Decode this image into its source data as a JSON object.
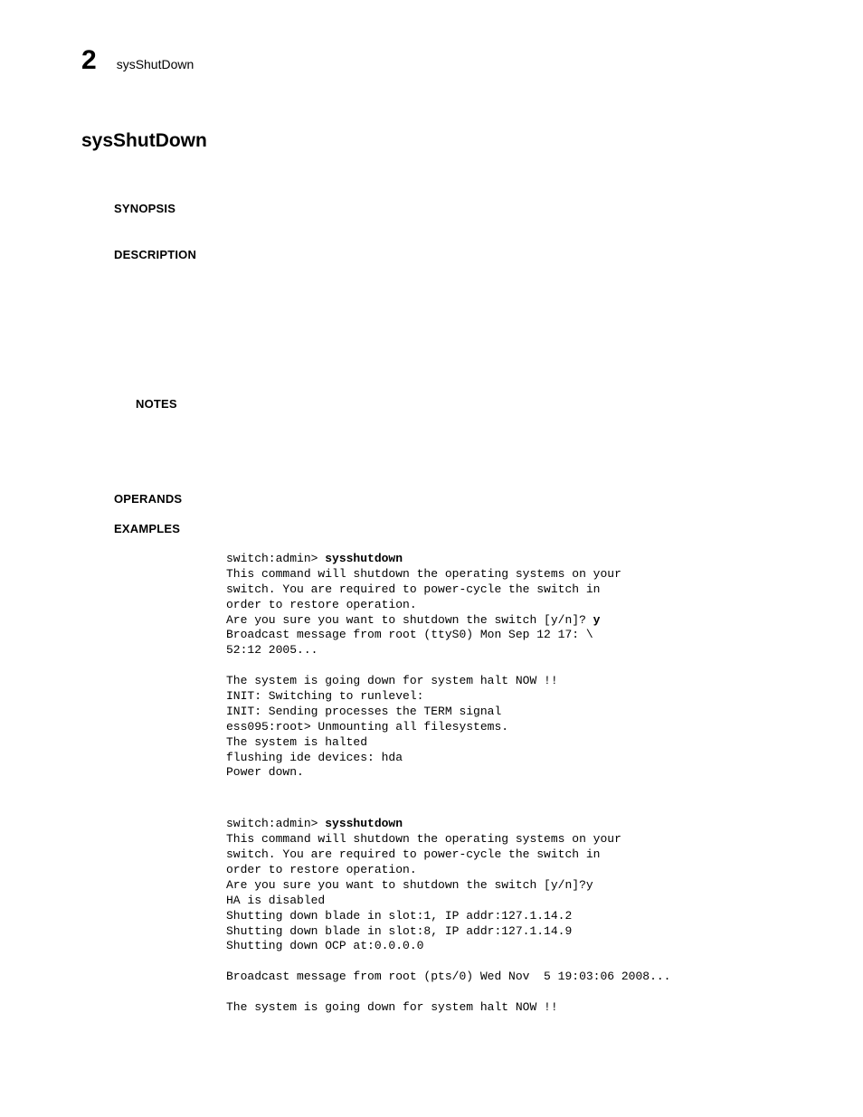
{
  "header": {
    "chapter_number": "2",
    "tag": "sysShutDown"
  },
  "title": "sysShutDown",
  "sections": {
    "synopsis_label": "SYNOPSIS",
    "description_label": "DESCRIPTION",
    "notes_label": "NOTES",
    "operands_label": "OPERANDS",
    "examples_label": "EXAMPLES"
  },
  "examples": {
    "block1": {
      "prompt1": "switch:admin> ",
      "cmd1": "sysshutdown",
      "body1": "This command will shutdown the operating systems on your\nswitch. You are required to power-cycle the switch in\norder to restore operation.\nAre you sure you want to shutdown the switch [y/n]? ",
      "input1": "y",
      "body1b": "Broadcast message from root (ttyS0) Mon Sep 12 17: \\\n52:12 2005...\n\nThe system is going down for system halt NOW !!\nINIT: Switching to runlevel:\nINIT: Sending processes the TERM signal\ness095:root> Unmounting all filesystems.\nThe system is halted\nflushing ide devices: hda\nPower down."
    },
    "block2": {
      "prompt2": "switch:admin> ",
      "cmd2": "sysshutdown",
      "body2": "This command will shutdown the operating systems on your\nswitch. You are required to power-cycle the switch in\norder to restore operation.\nAre you sure you want to shutdown the switch [y/n]?y\nHA is disabled\nShutting down blade in slot:1, IP addr:127.1.14.2\nShutting down blade in slot:8, IP addr:127.1.14.9\nShutting down OCP at:0.0.0.0\n\nBroadcast message from root (pts/0) Wed Nov  5 19:03:06 2008...\n\nThe system is going down for system halt NOW !!"
    }
  }
}
